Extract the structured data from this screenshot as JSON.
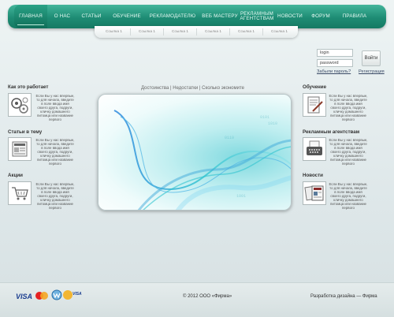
{
  "nav": {
    "items": [
      {
        "label": "ГЛАВНАЯ",
        "active": true
      },
      {
        "label": "О НАС"
      },
      {
        "label": "СТАТЬИ"
      },
      {
        "label": "ОБУЧЕНИЕ"
      },
      {
        "label": "РЕКЛАМОДАТЕЛЮ"
      },
      {
        "label": "ВЕБ МАСТЕРУ"
      },
      {
        "label": "РЕКЛАМНЫМ АГЕНТСТВАМ"
      },
      {
        "label": "НОВОСТИ"
      },
      {
        "label": "ФОРУМ"
      },
      {
        "label": "ПРАВИЛА"
      }
    ],
    "colors": {
      "bar": "#1e8c74",
      "text": "#e9fbf5"
    }
  },
  "subnav": {
    "links": [
      "Ссылка 1",
      "Ссылка 1",
      "Ссылка 1",
      "Ссылка 1",
      "Ссылка 1",
      "Ссылка 1"
    ]
  },
  "login": {
    "login_value": "login",
    "password_value": "password",
    "submit_label": "Войти",
    "forgot_label": "Забыли пароль?",
    "register_label": "Регистрация"
  },
  "tabs": {
    "items": [
      "Достоинства",
      "Недостатки",
      "Сколько экономите"
    ],
    "separator": " | "
  },
  "left_sections": [
    {
      "title": "Как это работает",
      "icon": "gears-icon",
      "text": "Если Вы у нас впервые, то для начала, введите в поле ввода имя своего друга, подруги, кличку домашнего питомца или название первого"
    },
    {
      "title": "Статьи в тему",
      "icon": "newspaper-icon",
      "text": "Если Вы у нас впервые, то для начала, введите в поле ввода имя своего друга, подруги, кличку домашнего питомца или название первого"
    },
    {
      "title": "Акции",
      "icon": "shopping-cart-icon",
      "text": "Если Вы у нас впервые, то для начала, введите в поле ввода имя своего друга, подруги, кличку домашнего питомца или название первого"
    }
  ],
  "right_sections": [
    {
      "title": "Обучение",
      "icon": "document-pen-icon",
      "text": "Если Вы у нас впервые, то для начала, введите в поле ввода имя своего друга, подруги, кличку домашнего питомца или название первого"
    },
    {
      "title": "Рекламным агентствам",
      "icon": "typewriter-icon",
      "text": "Если Вы у нас впервые, то для начала, введите в поле ввода имя своего друга, подруги, кличку домашнего питомца или название первого"
    },
    {
      "title": "Новости",
      "icon": "newspapers-icon",
      "text": "Если Вы у нас впервые, то для начала, введите в поле ввода имя своего друга, подруги, кличку домашнего питомца или название первого"
    }
  ],
  "hero": {
    "image": "abstract-waves-image"
  },
  "footer": {
    "copyright": "© 2012 ООО «Фирма»",
    "credit": "Разработка дизайна — Фирма",
    "payment_logos": [
      "VISA",
      "MasterCard",
      "WebMoney",
      "VISA Electron"
    ]
  }
}
